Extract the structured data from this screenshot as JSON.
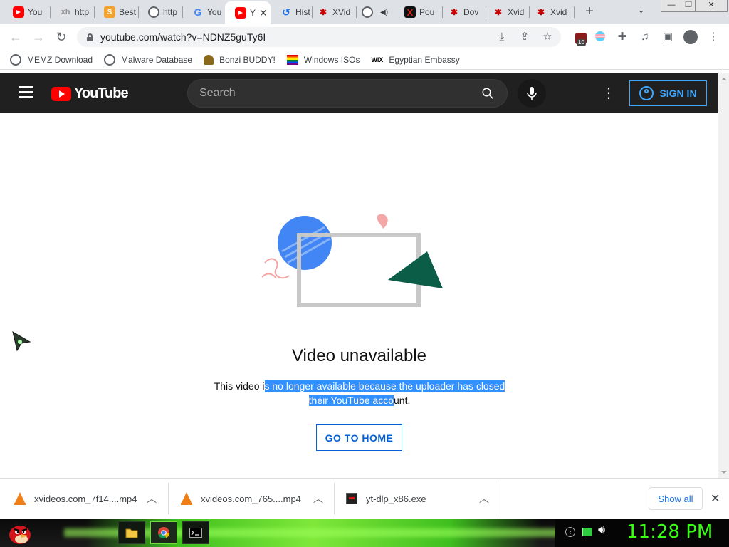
{
  "browser": {
    "tabs": [
      {
        "title": "You",
        "favicon": "youtube-icon"
      },
      {
        "title": "http",
        "favicon": "xhamster-icon"
      },
      {
        "title": "Best",
        "favicon": "blogger-icon"
      },
      {
        "title": "http",
        "favicon": "globe-icon"
      },
      {
        "title": "You",
        "favicon": "google-icon"
      },
      {
        "title": "Y",
        "favicon": "youtube-icon",
        "active": true
      },
      {
        "title": "Hist",
        "favicon": "history-icon"
      },
      {
        "title": "XVid",
        "favicon": "xvideos-icon"
      },
      {
        "title": "",
        "favicon": "globe-icon"
      },
      {
        "title": "Pou",
        "favicon": "x-icon"
      },
      {
        "title": "Dov",
        "favicon": "xvideos-icon"
      },
      {
        "title": "Xvid",
        "favicon": "xvideos-icon"
      },
      {
        "title": "Xvid",
        "favicon": "xvideos-icon"
      }
    ],
    "url": "youtube.com/watch?v=NDNZ5guTy6I",
    "extension_badge": "10",
    "bookmarks": [
      {
        "label": "MEMZ Download",
        "icon": "globe-icon"
      },
      {
        "label": "Malware Database",
        "icon": "globe-icon"
      },
      {
        "label": "Bonzi BUDDY!",
        "icon": "bonzi-icon"
      },
      {
        "label": "Windows ISOs",
        "icon": "rainbow-flag-icon"
      },
      {
        "label": "Egyptian Embassy",
        "icon": "wix-icon",
        "icon_text": "WiX"
      }
    ]
  },
  "youtube": {
    "logo_text": "YouTube",
    "search_placeholder": "Search",
    "signin_label": "SIGN IN"
  },
  "main": {
    "title": "Video unavailable",
    "message_part1": "This video i",
    "message_selected": "s no longer available because the uploader has closed their YouTube acco",
    "message_part2": "unt.",
    "home_button": "GO TO HOME"
  },
  "downloads": {
    "items": [
      {
        "name": "xvideos.com_7f14....mp4",
        "icon": "vlc-icon"
      },
      {
        "name": "xvideos.com_765....mp4",
        "icon": "vlc-icon"
      },
      {
        "name": "yt-dlp_x86.exe",
        "icon": "exe-icon"
      }
    ],
    "show_all": "Show all"
  },
  "taskbar": {
    "clock": "11:28 PM"
  },
  "colors": {
    "yt_red": "#ff0000",
    "yt_header": "#202020",
    "selection": "#3390ff",
    "link_blue": "#065fd4",
    "clock_green": "#39ff14"
  }
}
